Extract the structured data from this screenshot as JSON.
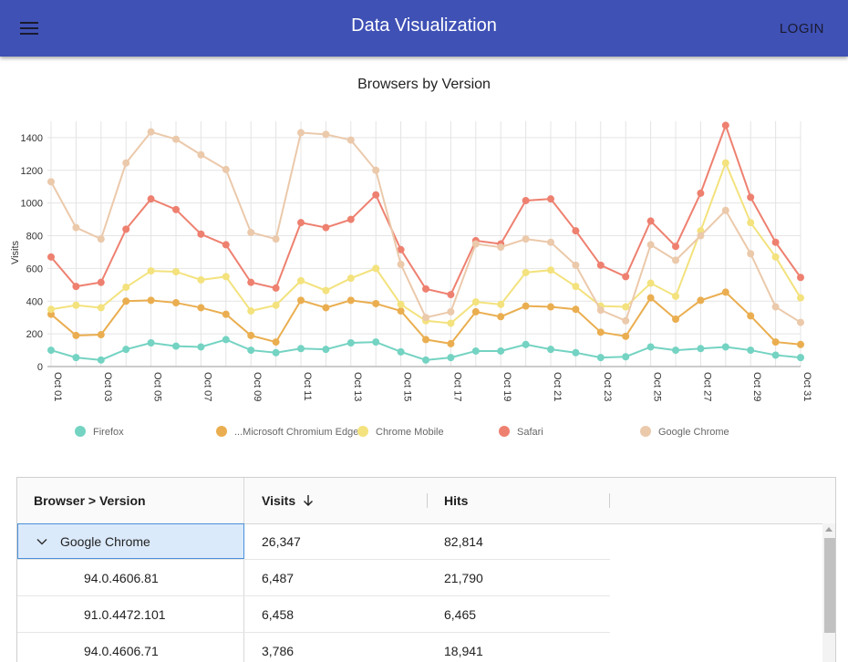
{
  "app": {
    "title": "Data Visualization",
    "login_label": "LOGIN"
  },
  "chart_data": {
    "type": "line",
    "title": "Browsers by Version",
    "ylabel": "Visits",
    "xlabel": "",
    "ylim": [
      0,
      1500
    ],
    "yticks": [
      0,
      200,
      400,
      600,
      800,
      1000,
      1200,
      1400
    ],
    "x": [
      "Oct 01",
      "Oct 02",
      "Oct 03",
      "Oct 04",
      "Oct 05",
      "Oct 06",
      "Oct 07",
      "Oct 08",
      "Oct 09",
      "Oct 10",
      "Oct 11",
      "Oct 12",
      "Oct 13",
      "Oct 14",
      "Oct 15",
      "Oct 16",
      "Oct 17",
      "Oct 18",
      "Oct 19",
      "Oct 20",
      "Oct 21",
      "Oct 22",
      "Oct 23",
      "Oct 24",
      "Oct 25",
      "Oct 26",
      "Oct 27",
      "Oct 28",
      "Oct 29",
      "Oct 30",
      "Oct 31"
    ],
    "xtick_labels": [
      "Oct 01",
      "Oct 03",
      "Oct 05",
      "Oct 07",
      "Oct 09",
      "Oct 11",
      "Oct 13",
      "Oct 15",
      "Oct 17",
      "Oct 19",
      "Oct 21",
      "Oct 23",
      "Oct 25",
      "Oct 27",
      "Oct 29",
      "Oct 31"
    ],
    "grid": true,
    "legend_position": "bottom",
    "series": [
      {
        "name": "Firefox",
        "color": "#74d3c2",
        "values": [
          100,
          55,
          40,
          105,
          145,
          125,
          120,
          165,
          100,
          85,
          110,
          105,
          145,
          150,
          90,
          40,
          55,
          95,
          95,
          135,
          105,
          85,
          55,
          60,
          120,
          100,
          110,
          120,
          100,
          70,
          55
        ]
      },
      {
        "name": "...Microsoft Chromium Edge",
        "color": "#eaae50",
        "values": [
          320,
          190,
          195,
          400,
          405,
          390,
          360,
          320,
          190,
          150,
          405,
          360,
          405,
          385,
          340,
          165,
          140,
          335,
          305,
          370,
          365,
          350,
          210,
          185,
          420,
          290,
          405,
          455,
          310,
          150,
          135
        ]
      },
      {
        "name": "Chrome Mobile",
        "color": "#f3e27d",
        "values": [
          350,
          375,
          360,
          485,
          585,
          580,
          530,
          550,
          340,
          375,
          525,
          465,
          540,
          600,
          380,
          280,
          265,
          395,
          380,
          575,
          590,
          490,
          370,
          365,
          510,
          430,
          830,
          1245,
          880,
          670,
          420
        ]
      },
      {
        "name": "Safari",
        "color": "#ee8070",
        "values": [
          670,
          490,
          515,
          840,
          1025,
          960,
          810,
          745,
          515,
          480,
          880,
          850,
          900,
          1050,
          715,
          475,
          440,
          770,
          750,
          1015,
          1025,
          830,
          620,
          550,
          890,
          735,
          1060,
          1475,
          1035,
          760,
          545
        ]
      },
      {
        "name": "Google Chrome",
        "color": "#ebc9ab",
        "values": [
          1130,
          850,
          780,
          1245,
          1435,
          1390,
          1295,
          1205,
          820,
          780,
          1430,
          1420,
          1385,
          1200,
          625,
          300,
          335,
          750,
          730,
          780,
          760,
          620,
          345,
          280,
          745,
          650,
          800,
          955,
          690,
          365,
          270
        ]
      }
    ]
  },
  "grid": {
    "columns": [
      {
        "label": "Browser > Version"
      },
      {
        "label": "Visits",
        "sort_icon": "arrow-down-icon"
      },
      {
        "label": "Hits"
      }
    ],
    "rows": [
      {
        "name": "Google Chrome",
        "visits": "26,347",
        "hits": "82,814",
        "expanded_icon": "chevron-down-icon"
      },
      {
        "name": "94.0.4606.81",
        "visits": "6,487",
        "hits": "21,790"
      },
      {
        "name": "91.0.4472.101",
        "visits": "6,458",
        "hits": "6,465"
      },
      {
        "name": "94.0.4606.71",
        "visits": "3,786",
        "hits": "18,941"
      }
    ]
  }
}
